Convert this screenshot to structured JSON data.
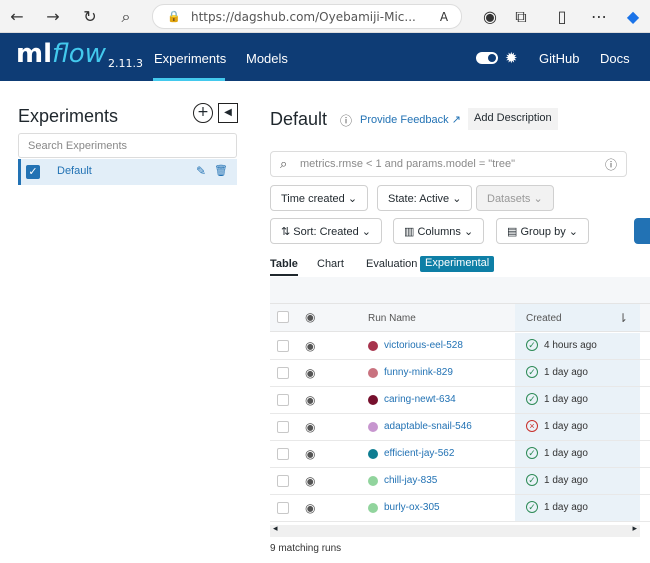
{
  "browser": {
    "url_host": "https://dagshub.com",
    "url_path": "/Oyebamiji-Mic..."
  },
  "navbar": {
    "logo_ml": "ml",
    "logo_flow": "flow",
    "version": "2.11.3",
    "links": [
      "Experiments",
      "Models",
      "GitHub",
      "Docs"
    ]
  },
  "sidebar": {
    "title": "Experiments",
    "search_placeholder": "Search Experiments",
    "experiment": "Default"
  },
  "main": {
    "title": "Default",
    "feedback": "Provide Feedback",
    "description_button": "Add Description",
    "search_placeholder": "metrics.rmse < 1 and params.model = \"tree\"",
    "filters": {
      "time": "Time created",
      "state": "State: Active",
      "datasets": "Datasets",
      "sort": "Sort: Created",
      "columns": "Columns",
      "group": "Group by"
    },
    "tabs": {
      "table": "Table",
      "chart": "Chart",
      "evaluation": "Evaluation",
      "badge": "Experimental"
    },
    "headers": {
      "run_name": "Run Name",
      "created": "Created"
    },
    "runs": [
      {
        "name": "victorious-eel-528",
        "color": "#a7344d",
        "status": "success",
        "time": "4 hours ago"
      },
      {
        "name": "funny-mink-829",
        "color": "#c9727f",
        "status": "success",
        "time": "1 day ago"
      },
      {
        "name": "caring-newt-634",
        "color": "#76102d",
        "status": "success",
        "time": "1 day ago"
      },
      {
        "name": "adaptable-snail-546",
        "color": "#c796cf",
        "status": "failed",
        "time": "1 day ago"
      },
      {
        "name": "efficient-jay-562",
        "color": "#0e7d91",
        "status": "success",
        "time": "1 day ago"
      },
      {
        "name": "chill-jay-835",
        "color": "#91d49d",
        "status": "success",
        "time": "1 day ago"
      },
      {
        "name": "burly-ox-305",
        "color": "#91d49d",
        "status": "success",
        "time": "1 day ago"
      }
    ],
    "matching": "9 matching runs"
  },
  "colors": {
    "navbar": "#0e3c75",
    "accent": "#43c9ed",
    "link": "#2272b4",
    "success": "#2e8b57",
    "failed": "#c8302c"
  }
}
